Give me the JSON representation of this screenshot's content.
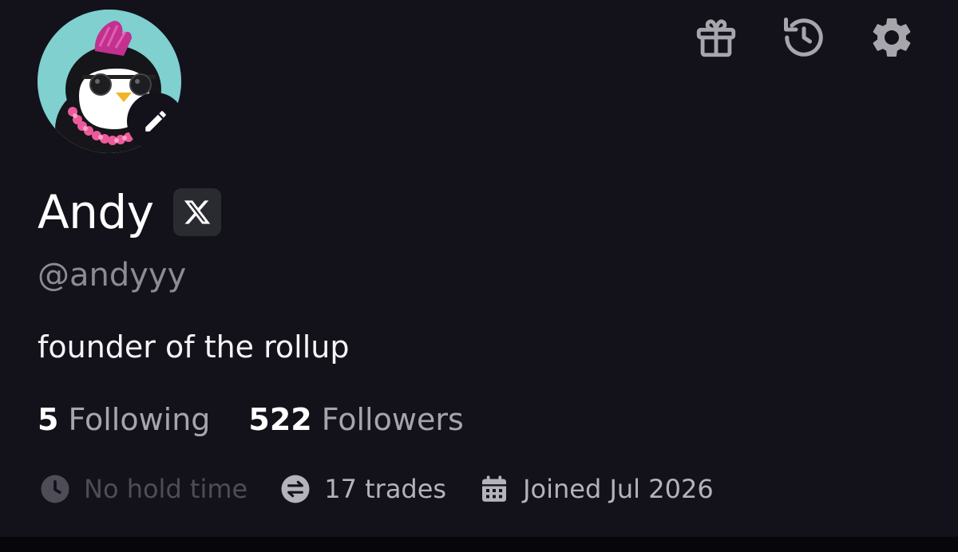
{
  "profile": {
    "name": "Andy",
    "handle": "@andyyy",
    "bio": "founder of the rollup",
    "avatar_icon": "penguin-avatar",
    "social_badge_icon": "x-logo-icon"
  },
  "stats": {
    "following_count": "5",
    "following_label": "Following",
    "followers_count": "522",
    "followers_label": "Followers"
  },
  "meta": {
    "hold_time": "No hold time",
    "trades": "17 trades",
    "joined": "Joined Jul 2026"
  },
  "toolbar": {
    "icons": [
      "gift-icon",
      "history-icon",
      "settings-gear-icon"
    ]
  },
  "colors": {
    "background": "#13121b",
    "text_primary": "#ffffff",
    "text_secondary": "#8c8b94",
    "icon_gray": "#a7a6ad",
    "avatar_bg": "#7fd0cf",
    "mohawk": "#c2318f"
  }
}
